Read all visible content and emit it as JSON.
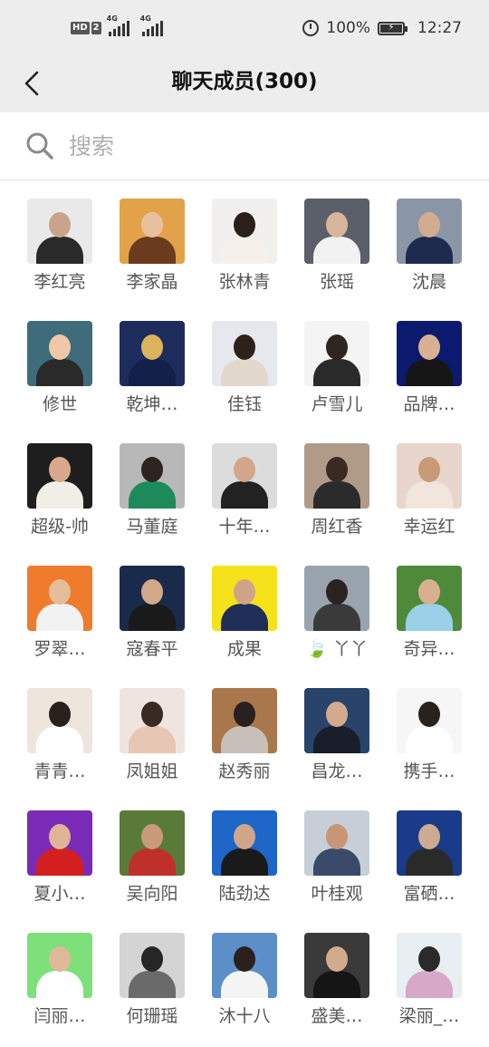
{
  "status_bar": {
    "hd_label": "HD",
    "sim_label": "2",
    "net1": "4G",
    "net2": "4G",
    "battery_percent": "100%",
    "time": "12:27"
  },
  "header": {
    "title": "聊天成员(300)",
    "back_icon": "chevron-left-icon"
  },
  "search": {
    "placeholder": "搜索",
    "value": "",
    "icon": "search-icon"
  },
  "members": [
    {
      "name": "李红亮",
      "bg": "#e9e9e9",
      "head": "#caa48a",
      "body": "#2a2a2a"
    },
    {
      "name": "李家晶",
      "bg": "#e2a24a",
      "head": "#e8c0a0",
      "body": "#6b3b1e"
    },
    {
      "name": "张林青",
      "bg": "#f2f0ee",
      "head": "#2a1f1a",
      "body": "#f5f0ea"
    },
    {
      "name": "张瑶",
      "bg": "#5a5f6a",
      "head": "#d8b49a",
      "body": "#f2f2f2"
    },
    {
      "name": "沈晨",
      "bg": "#8a96a6",
      "head": "#d2ac90",
      "body": "#1e2b4e"
    },
    {
      "name": "修世",
      "bg": "#3f6c7a",
      "head": "#f0c8a8",
      "body": "#2a2a2a"
    },
    {
      "name": "乾坤…",
      "bg": "#1d2c5c",
      "head": "#d9b45a",
      "body": "#12204a"
    },
    {
      "name": "佳钰",
      "bg": "#e6e8ee",
      "head": "#2d211c",
      "body": "#e3d8cc"
    },
    {
      "name": "卢雪儿",
      "bg": "#f4f4f4",
      "head": "#2f2521",
      "body": "#2a2a2a"
    },
    {
      "name": "品牌…",
      "bg": "#0b1a6e",
      "head": "#d8b092",
      "body": "#161616"
    },
    {
      "name": "超级-帅",
      "bg": "#1e1e1e",
      "head": "#d9a88c",
      "body": "#f1eee8"
    },
    {
      "name": "马董庭",
      "bg": "#b8b8b8",
      "head": "#2b2420",
      "body": "#1e8a5c"
    },
    {
      "name": "十年…",
      "bg": "#dcdcdc",
      "head": "#d2a68a",
      "body": "#222222"
    },
    {
      "name": "周红香",
      "bg": "#b09a88",
      "head": "#3a2a22",
      "body": "#2b2b2b"
    },
    {
      "name": "幸运红",
      "bg": "#e8d6cc",
      "head": "#c89a76",
      "body": "#f2e6dc"
    },
    {
      "name": "罗翠…",
      "bg": "#ef7b2c",
      "head": "#e4be9c",
      "body": "#f2f2f2"
    },
    {
      "name": "寇春平",
      "bg": "#1a2a4a",
      "head": "#d2a88a",
      "body": "#1a1a1a"
    },
    {
      "name": "成果",
      "bg": "#f5e21a",
      "head": "#cfa488",
      "body": "#1f2f58"
    },
    {
      "name": "🍃 丫丫",
      "bg": "#9aa4ae",
      "head": "#2c2220",
      "body": "#3a3a3a"
    },
    {
      "name": "奇异…",
      "bg": "#4f8a3a",
      "head": "#d8b090",
      "body": "#9ad0e8"
    },
    {
      "name": "青青…",
      "bg": "#eee6dc",
      "head": "#2a201c",
      "body": "#ffffff"
    },
    {
      "name": "凤姐姐",
      "bg": "#f0e4e0",
      "head": "#3a2a24",
      "body": "#e8c6b4"
    },
    {
      "name": "赵秀丽",
      "bg": "#a8784c",
      "head": "#2a2020",
      "body": "#c8c0b8"
    },
    {
      "name": "昌龙…",
      "bg": "#28446a",
      "head": "#d4aa8c",
      "body": "#1a1e2a"
    },
    {
      "name": "携手…",
      "bg": "#f6f6f6",
      "head": "#2a201c",
      "body": "#ffffff"
    },
    {
      "name": "夏小…",
      "bg": "#7b2ab8",
      "head": "#e0b498",
      "body": "#d21f1f"
    },
    {
      "name": "吴向阳",
      "bg": "#5a7a3a",
      "head": "#c89a7a",
      "body": "#c0302a"
    },
    {
      "name": "陆劲达",
      "bg": "#1e66c8",
      "head": "#d0a68a",
      "body": "#1a1a1a"
    },
    {
      "name": "叶桂观",
      "bg": "#c6cfd8",
      "head": "#c89676",
      "body": "#3a4a6a"
    },
    {
      "name": "富硒…",
      "bg": "#1a3a8a",
      "head": "#ccab90",
      "body": "#2a2a2a"
    },
    {
      "name": "闫丽…",
      "bg": "#7de07a",
      "head": "#e0b89a",
      "body": "#ffffff"
    },
    {
      "name": "何珊瑶",
      "bg": "#d4d4d4",
      "head": "#262626",
      "body": "#6a6a6a"
    },
    {
      "name": "沐十八",
      "bg": "#5c8ec8",
      "head": "#2a201c",
      "body": "#f4f4f4"
    },
    {
      "name": "盛美…",
      "bg": "#3a3a3a",
      "head": "#d2aa8c",
      "body": "#151515"
    },
    {
      "name": "梁丽_…",
      "bg": "#e8eef2",
      "head": "#2a2a2a",
      "body": "#d8a8c8"
    }
  ]
}
